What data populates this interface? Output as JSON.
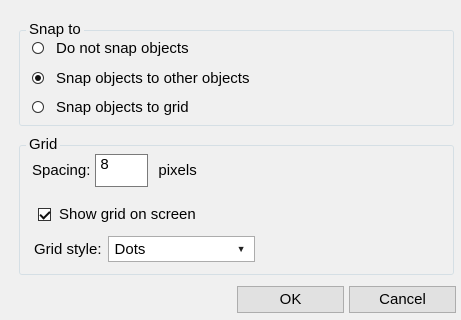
{
  "snap_group": {
    "legend": "Snap to",
    "options": [
      {
        "label": "Do not snap objects",
        "checked": false
      },
      {
        "label": "Snap objects to other objects",
        "checked": true
      },
      {
        "label": "Snap objects to grid",
        "checked": false
      }
    ]
  },
  "grid_group": {
    "legend": "Grid",
    "spacing_label": "Spacing:",
    "spacing_value": "8",
    "spacing_unit": "pixels",
    "show_grid_label": "Show grid on screen",
    "show_grid_checked": true,
    "style_label": "Grid style:",
    "style_value": "Dots",
    "style_caret_icon": "chevron-down-icon"
  },
  "buttons": {
    "ok_label": "OK",
    "cancel_label": "Cancel"
  }
}
